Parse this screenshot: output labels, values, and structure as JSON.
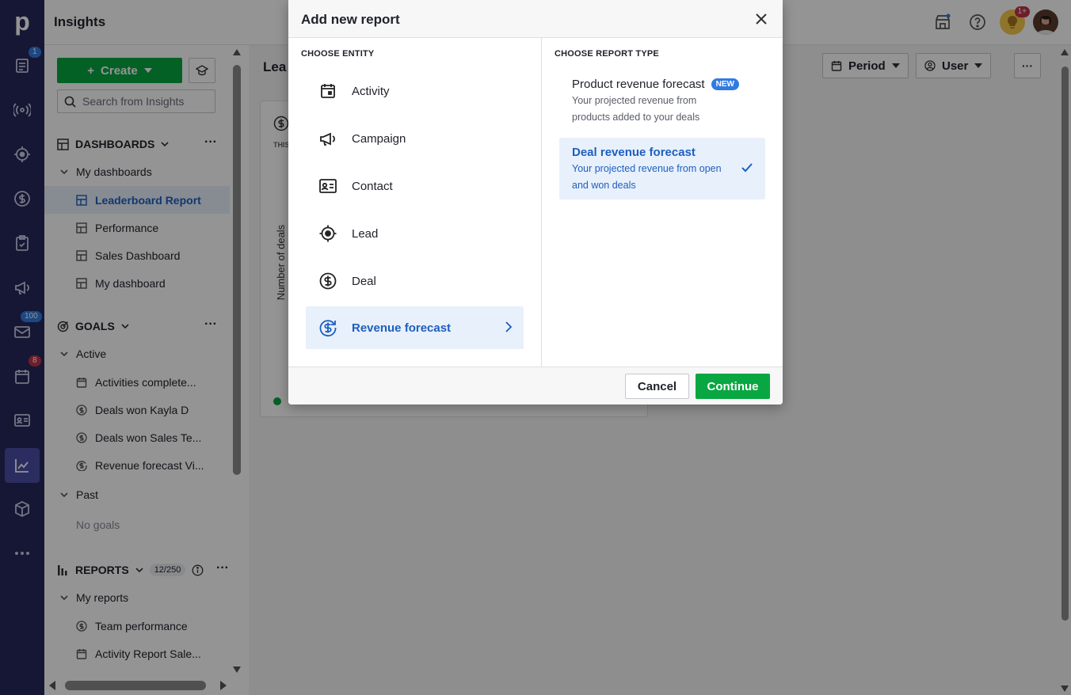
{
  "topbar": {
    "title": "Insights"
  },
  "rail": {
    "badges": {
      "leads": "1",
      "mail": "100",
      "activities": "8"
    }
  },
  "notifications": {
    "bulb_badge": "1+"
  },
  "sidebar": {
    "create_label": "Create",
    "search_placeholder": "Search from Insights",
    "dashboards": {
      "label": "DASHBOARDS",
      "group": "My dashboards",
      "items": [
        "Leaderboard Report",
        "Performance",
        "Sales Dashboard",
        "My dashboard"
      ]
    },
    "goals": {
      "label": "GOALS",
      "active_group": "Active",
      "active_items": [
        "Activities complete...",
        "Deals won Kayla D",
        "Deals won Sales Te...",
        "Revenue forecast Vi..."
      ],
      "past_group": "Past",
      "past_empty": "No goals"
    },
    "reports": {
      "label": "REPORTS",
      "count": "12/250",
      "group": "My reports",
      "items": [
        "Team performance",
        "Activity Report Sale..."
      ]
    }
  },
  "main": {
    "heading": "Lea",
    "period_label": "Period",
    "user_label": "User",
    "card_small_label": "THIS",
    "card_axis_label": "Number of deals"
  },
  "modal": {
    "title": "Add new report",
    "entity_title": "CHOOSE ENTITY",
    "report_title": "CHOOSE REPORT TYPE",
    "entities": [
      "Activity",
      "Campaign",
      "Contact",
      "Lead",
      "Deal",
      "Revenue forecast"
    ],
    "selected_entity": "Revenue forecast",
    "report_types": [
      {
        "title": "Product revenue forecast",
        "badge": "NEW",
        "desc": "Your projected revenue from products added to your deals"
      },
      {
        "title": "Deal revenue forecast",
        "badge": "",
        "desc": "Your projected revenue from open and won deals"
      }
    ],
    "selected_report": "Deal revenue forecast",
    "cancel_label": "Cancel",
    "continue_label": "Continue"
  },
  "colors": {
    "rail": "#26295a",
    "accent_green": "#08a742",
    "selection_blue": "#1d5fbf",
    "selection_bg": "#e8f0fb"
  }
}
